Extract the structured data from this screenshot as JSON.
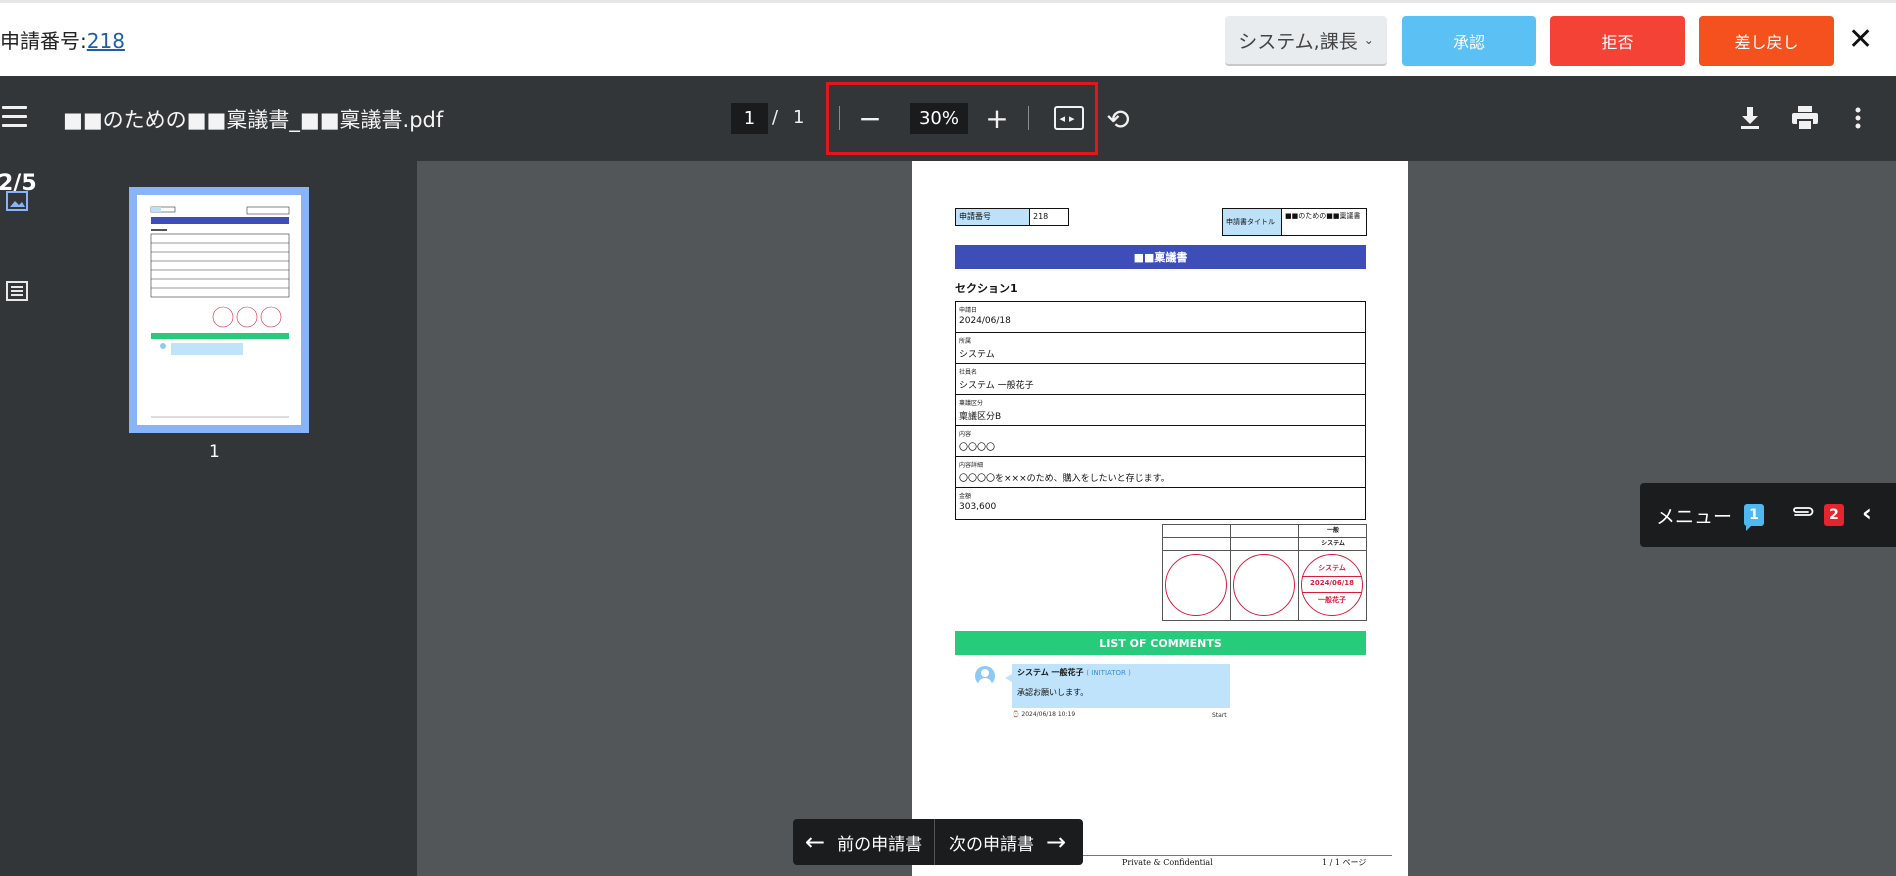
{
  "header": {
    "request_label": "申請番号:",
    "request_number": "218",
    "role_dropdown": "システム,課長",
    "approve_label": "承認",
    "reject_label": "拒否",
    "sendback_label": "差し戻し",
    "close_glyph": "✕"
  },
  "viewer": {
    "filename": "■■のための■■稟議書_■■稟議書.pdf",
    "current_page": "1",
    "page_sep": "/",
    "total_pages": "1",
    "zoom": "30%",
    "minus_glyph": "−",
    "plus_glyph": "+"
  },
  "sidebar": {
    "page_counter": "2/5",
    "thumb_label": "1"
  },
  "document": {
    "req_no_label": "申請番号",
    "req_no_value": "218",
    "title_label": "申請書タイトル",
    "title_value": "■■のための■■稟議書",
    "form_title": "■■稟議書",
    "section_title": "セクション1",
    "fields": [
      {
        "label": "申請日",
        "value": "2024/06/18"
      },
      {
        "label": "所属",
        "value": "システム"
      },
      {
        "label": "社員名",
        "value": "システム 一般花子"
      },
      {
        "label": "稟議区分",
        "value": "稟議区分B"
      },
      {
        "label": "内容",
        "value": "〇〇〇〇"
      },
      {
        "label": "内容詳細",
        "value": "〇〇〇〇を×××のため、購入をしたいと存じます。"
      },
      {
        "label": "金額",
        "value": "303,600"
      }
    ],
    "stamp": {
      "col_header": "一般",
      "dept": "システム",
      "seal_top": "システム",
      "seal_date": "2024/06/18",
      "seal_name": "一般花子"
    },
    "comments_title": "LIST OF COMMENTS",
    "comment": {
      "author": "システム 一般花子",
      "role": "( INITIATOR )",
      "message": "承認お願いします。",
      "time": "⌚ 2024/06/18 10:19",
      "status": "Start"
    },
    "footer_center": "Private & Confidential",
    "footer_right": "1 / 1 ページ"
  },
  "float_menu": {
    "label": "メニュー",
    "comment_count": "1",
    "attachment_count": "2"
  },
  "nav": {
    "prev_label": "前の申請書",
    "next_label": "次の申請書"
  },
  "colors": {
    "approve": "#5bc0f4",
    "reject": "#f44336",
    "sendback": "#f4511e",
    "toolbar": "#323639",
    "canvas": "#525659",
    "form_title_bar": "#3d4eb8",
    "comments_bar": "#26cc7a",
    "highlight": "#e0171f"
  }
}
